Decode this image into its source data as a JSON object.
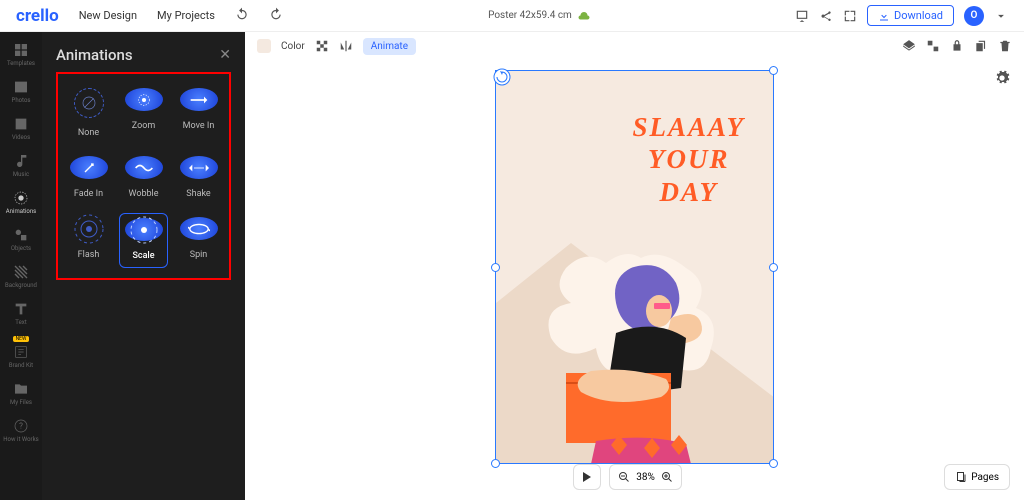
{
  "topbar": {
    "logo": "crello",
    "links": [
      "New Design",
      "My Projects"
    ],
    "doc_title": "Poster 42x59.4 cm",
    "download": "Download",
    "avatar_letter": "O"
  },
  "secbar": {
    "color_label": "Color",
    "animate_label": "Animate"
  },
  "rail": [
    {
      "id": "templates",
      "label": "Templates"
    },
    {
      "id": "photos",
      "label": "Photos"
    },
    {
      "id": "videos",
      "label": "Videos"
    },
    {
      "id": "music",
      "label": "Music"
    },
    {
      "id": "animations",
      "label": "Animations",
      "active": true
    },
    {
      "id": "objects",
      "label": "Objects"
    },
    {
      "id": "background",
      "label": "Background"
    },
    {
      "id": "text",
      "label": "Text"
    },
    {
      "id": "brandkit",
      "label": "Brand Kit",
      "badge": "NEW"
    },
    {
      "id": "myfiles",
      "label": "My Files"
    },
    {
      "id": "howit",
      "label": "How it Works"
    }
  ],
  "panel": {
    "title": "Animations",
    "items": [
      {
        "id": "none",
        "label": "None"
      },
      {
        "id": "zoom",
        "label": "Zoom"
      },
      {
        "id": "movein",
        "label": "Move In"
      },
      {
        "id": "fadein",
        "label": "Fade In"
      },
      {
        "id": "wobble",
        "label": "Wobble"
      },
      {
        "id": "shake",
        "label": "Shake"
      },
      {
        "id": "flash",
        "label": "Flash"
      },
      {
        "id": "scale",
        "label": "Scale",
        "selected": true
      },
      {
        "id": "spin",
        "label": "Spin"
      }
    ]
  },
  "poster": {
    "line1": "SLAAAY",
    "line2": "YOUR",
    "line3": "DAY"
  },
  "zoom": {
    "value": "38%",
    "pages_label": "Pages"
  },
  "colors": {
    "brand": "#2962ff",
    "accent": "#ff5c26",
    "panel_bg": "#1e1e1e"
  }
}
